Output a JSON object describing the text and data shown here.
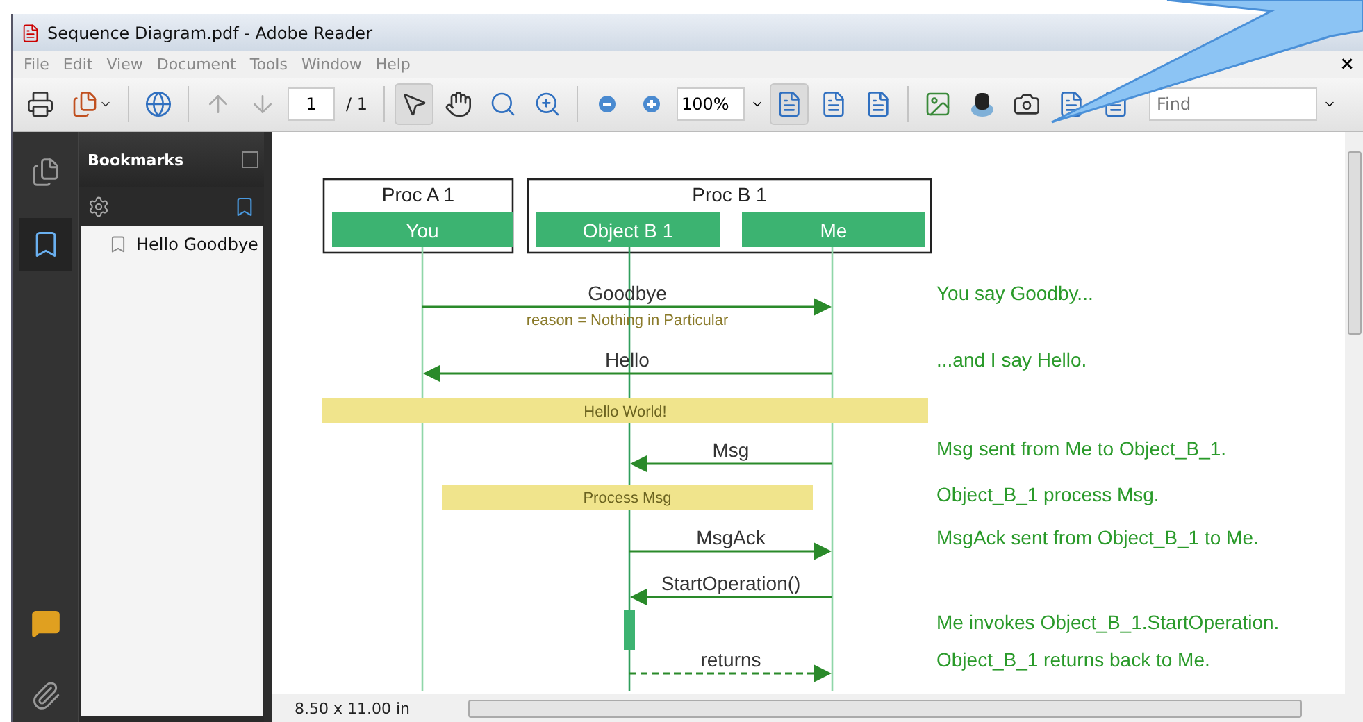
{
  "window": {
    "title": "Sequence Diagram.pdf - Adobe Reader"
  },
  "menu": [
    "File",
    "Edit",
    "View",
    "Document",
    "Tools",
    "Window",
    "Help"
  ],
  "menu_close": "×",
  "toolbar": {
    "page": "1",
    "page_count": "/ 1",
    "zoom": "100%",
    "find_placeholder": "Find",
    "select_tool_selected": true,
    "actual_size_selected": true
  },
  "sidebar": {
    "title": "Bookmarks",
    "items": [
      {
        "label": "Hello Goodbye"
      }
    ]
  },
  "diagram": {
    "groups": [
      {
        "label": "Proc A 1"
      },
      {
        "label": "Proc B 1"
      }
    ],
    "participants": [
      {
        "label": "You"
      },
      {
        "label": "Object B 1"
      },
      {
        "label": "Me"
      }
    ],
    "events": [
      {
        "kind": "message",
        "label": "Goodbye",
        "note": "reason = Nothing in Particular"
      },
      {
        "kind": "message",
        "label": "Hello"
      },
      {
        "kind": "note",
        "label": "Hello World!"
      },
      {
        "kind": "message",
        "label": "Msg"
      },
      {
        "kind": "note",
        "label": "Process Msg"
      },
      {
        "kind": "message",
        "label": "MsgAck"
      },
      {
        "kind": "message",
        "label": "StartOperation()"
      },
      {
        "kind": "activation"
      },
      {
        "kind": "return",
        "label": "returns"
      }
    ],
    "comments": [
      "You say Goodby...",
      "...and I say Hello.",
      "Msg sent from Me to Object_B_1.",
      "Object_B_1 process Msg.",
      "MsgAck sent from Object_B_1 to Me.",
      "Me invokes Object_B_1.StartOperation.",
      "Object_B_1 returns back to Me."
    ]
  },
  "status_bar": {
    "page_size": "8.50 x 11.00 in"
  }
}
